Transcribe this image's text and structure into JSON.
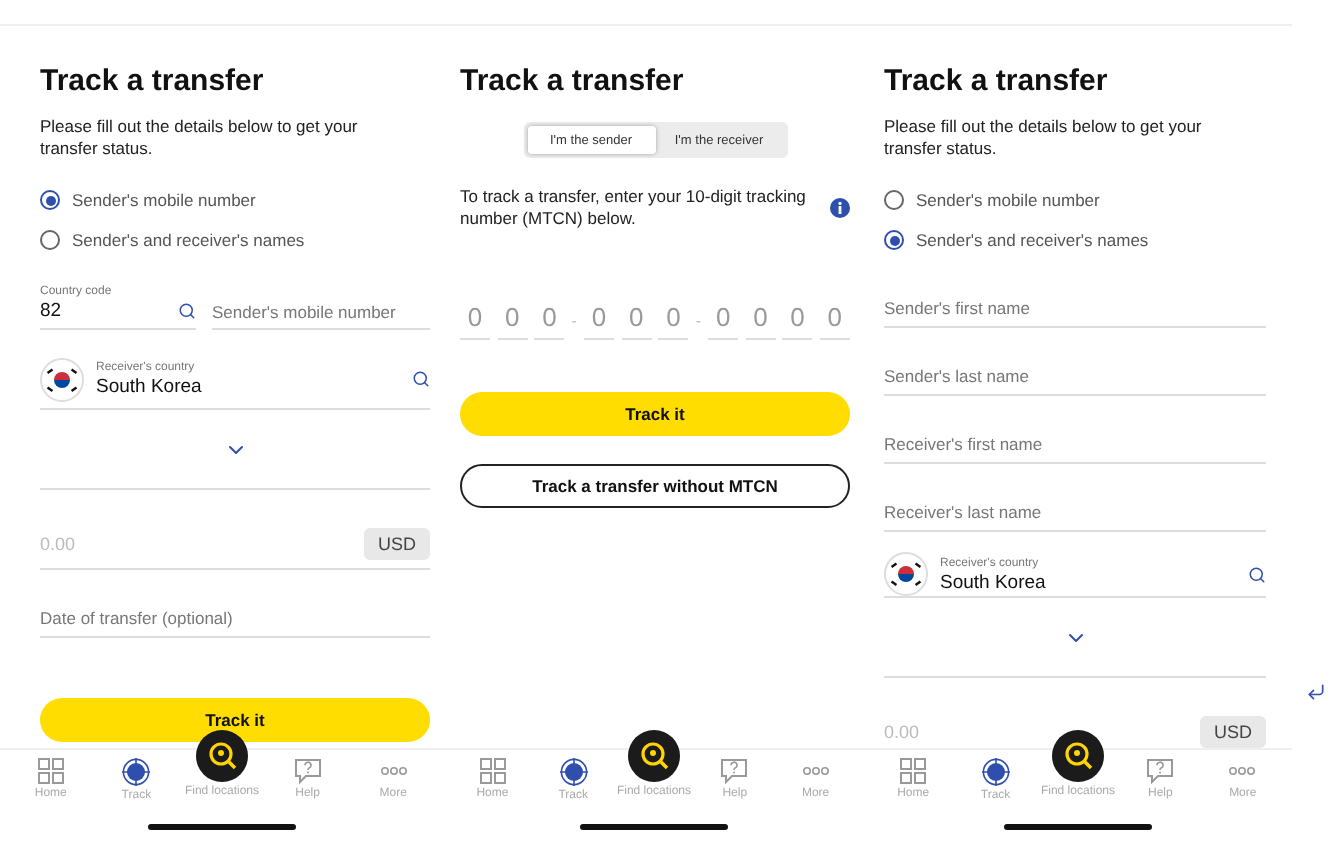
{
  "screens": [
    {
      "title": "Track a transfer",
      "blocks": [
        {
          "kind": "intro",
          "text": "Please fill out the details below to get your transfer status."
        },
        {
          "kind": "radios",
          "options": [
            {
              "label": "Sender's mobile number",
              "selected": true
            },
            {
              "label": "Sender's and receiver's names",
              "selected": false
            }
          ]
        },
        {
          "kind": "phone",
          "code_label": "Country code",
          "code": "82",
          "placeholder": "Sender's mobile number"
        },
        {
          "kind": "country",
          "label": "Receiver's country",
          "value": "South Korea"
        },
        {
          "kind": "expand"
        },
        {
          "kind": "amount",
          "placeholder": "0.00",
          "currency": "USD"
        },
        {
          "kind": "field",
          "placeholder": "Date of transfer (optional)"
        },
        {
          "kind": "button",
          "label": "Track it"
        }
      ],
      "nav": [
        {
          "label": "Home",
          "selected": false
        },
        {
          "label": "Track",
          "selected": true
        },
        {
          "label": "Find locations",
          "selected": false
        },
        {
          "label": "Help",
          "selected": false
        },
        {
          "label": "More",
          "selected": false
        }
      ]
    },
    {
      "title": "Track a transfer",
      "blocks": [
        {
          "kind": "segments",
          "options": [
            {
              "label": "I'm the sender",
              "selected": true
            },
            {
              "label": "I'm the receiver",
              "selected": false
            }
          ]
        },
        {
          "kind": "instruction",
          "text": "To track a transfer, enter your 10-digit tracking number (MTCN) below."
        },
        {
          "kind": "mtcn",
          "separator": "-",
          "groups": [
            [
              "0",
              "0",
              "0"
            ],
            [
              "0",
              "0",
              "0"
            ],
            [
              "0",
              "0",
              "0",
              "0"
            ]
          ]
        },
        {
          "kind": "button",
          "label": "Track it"
        },
        {
          "kind": "outline_button",
          "label": "Track a transfer without MTCN"
        }
      ],
      "nav": [
        {
          "label": "Home",
          "selected": false
        },
        {
          "label": "Track",
          "selected": true
        },
        {
          "label": "Find locations",
          "selected": false
        },
        {
          "label": "Help",
          "selected": false
        },
        {
          "label": "More",
          "selected": false
        }
      ]
    },
    {
      "title": "Track a transfer",
      "blocks": [
        {
          "kind": "intro",
          "text": "Please fill out the details below to get your transfer status."
        },
        {
          "kind": "radios",
          "options": [
            {
              "label": "Sender's mobile number",
              "selected": false
            },
            {
              "label": "Sender's and receiver's names",
              "selected": true
            }
          ]
        },
        {
          "kind": "field",
          "placeholder": "Sender's first name"
        },
        {
          "kind": "field",
          "placeholder": "Sender's last name"
        },
        {
          "kind": "field",
          "placeholder": "Receiver's first name"
        },
        {
          "kind": "field",
          "placeholder": "Receiver's last name"
        },
        {
          "kind": "country",
          "label": "Receiver's country",
          "value": "South Korea"
        },
        {
          "kind": "expand"
        },
        {
          "kind": "amount",
          "placeholder": "0.00",
          "currency": "USD"
        }
      ],
      "nav": [
        {
          "label": "Home",
          "selected": false
        },
        {
          "label": "Track",
          "selected": true
        },
        {
          "label": "Find locations",
          "selected": false
        },
        {
          "label": "Help",
          "selected": false
        },
        {
          "label": "More",
          "selected": false
        }
      ]
    }
  ]
}
